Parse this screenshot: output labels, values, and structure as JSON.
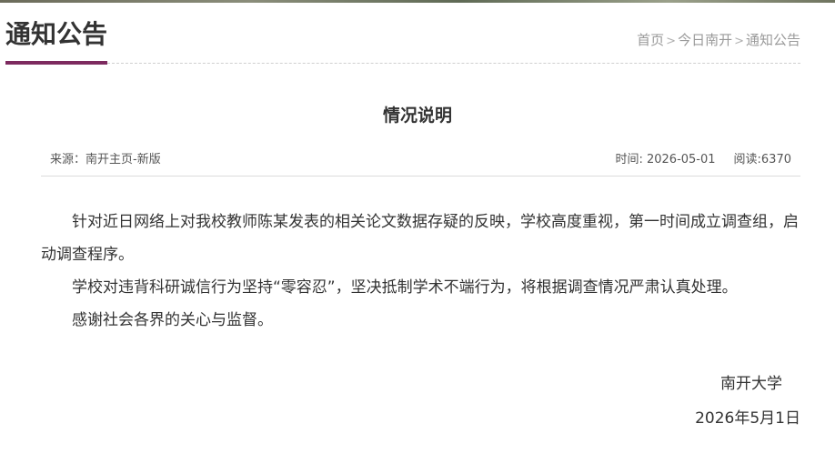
{
  "section": {
    "title": "通知公告"
  },
  "breadcrumb": {
    "items": [
      "首页",
      "今日南开",
      "通知公告"
    ],
    "separator": ">"
  },
  "article": {
    "title": "情况说明",
    "source": "来源：南开主页-新版",
    "time": "时间: 2026-05-01",
    "views": "阅读:6370",
    "paragraphs": [
      "针对近日网络上对我校教师陈某发表的相关论文数据存疑的反映，学校高度重视，第一时间成立调查组，启动调查程序。",
      "学校对违背科研诚信行为坚持“零容忍”，坚决抵制学术不端行为，将根据调查情况严肃认真处理。",
      "感谢社会各界的关心与监督。"
    ],
    "signature": "南开大学",
    "date": "2026年5月1日"
  },
  "colors": {
    "accent": "#7d2a5f",
    "text": "#333333",
    "muted": "#9a9a9a"
  }
}
